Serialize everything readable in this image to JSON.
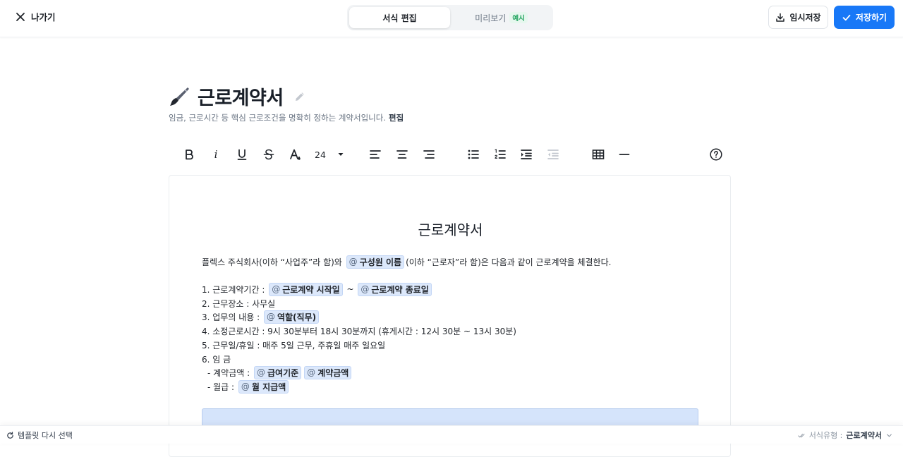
{
  "header": {
    "exit_label": "나가기",
    "tabs": {
      "edit": "서식 편집",
      "preview": "미리보기",
      "preview_badge": "예시"
    },
    "draft_label": "임시저장",
    "save_label": "저장하기"
  },
  "template": {
    "title": "근로계약서",
    "description": "임금, 근로시간 등 핵심 근로조건을 명확히 정하는 계약서입니다.",
    "edit_link": "편집"
  },
  "toolbar": {
    "italic": "i",
    "font_size": "24"
  },
  "document": {
    "heading": "근로계약서",
    "intro_before": "플렉스 주식회사(이하 “사업주”라 함)와",
    "intro_var": "구성원 이름",
    "intro_after": "(이하 “근로자”라 함)은 다음과 같이 근로계약을 체결한다.",
    "item1_label": "1. 근로계약기간 :",
    "item1_var_start": "근로계약 시작일",
    "item1_sep": "~",
    "item1_var_end": "근로계약 종료일",
    "item2": "2. 근무장소 : 사무실",
    "item3_label": "3. 업무의 내용 :",
    "item3_var": "역할(직무)",
    "item4": "4. 소정근로시간 :  9시 30분부터  18시 30분까지 (휴게시간 : 12시 30분 ~ 13시 30분)",
    "item5": "5. 근무일/휴일 : 매주 5일 근무, 주휴일 매주 일요일",
    "item6": "6. 임 금",
    "pay_label": "- 계약금액 :",
    "pay_var1": "급여기준",
    "pay_var2": "계약금액",
    "monthly_label": "- 월급 :",
    "monthly_var": "월 지급액",
    "at_symbol": "@"
  },
  "footer": {
    "reselect_label": "템플릿 다시 선택",
    "doctype_label": "서식유형 :",
    "doctype_value": "근로계약서"
  },
  "colors": {
    "primary": "#1878f7",
    "chip_bg": "#dce8fb",
    "badge_green": "#18a058"
  }
}
